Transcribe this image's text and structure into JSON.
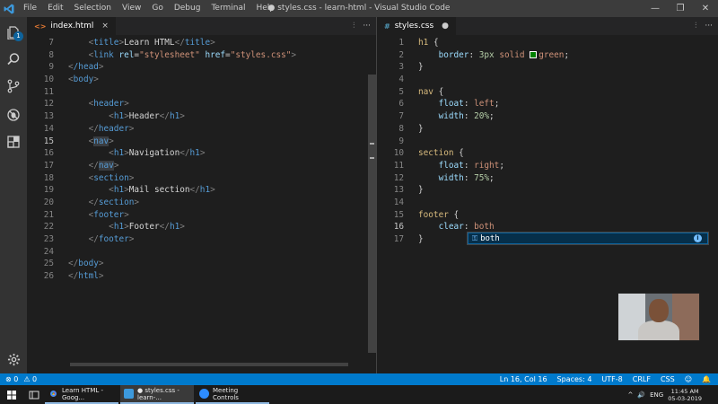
{
  "window": {
    "title": "● styles.css - learn-html - Visual Studio Code",
    "menu": [
      "File",
      "Edit",
      "Selection",
      "View",
      "Go",
      "Debug",
      "Terminal",
      "Help"
    ],
    "controls": [
      "—",
      "❐",
      "✕"
    ]
  },
  "activity": {
    "source_control_badge": "1",
    "icons": [
      "files-icon",
      "search-icon",
      "source-control-icon",
      "debug-icon",
      "extensions-icon",
      "settings-gear-icon"
    ]
  },
  "left_editor": {
    "tab": {
      "icon": "<>",
      "label": "index.html",
      "close": "×"
    },
    "actions": [
      "⫶",
      "···"
    ],
    "lines": [
      {
        "n": "7",
        "tokens": [
          [
            "    ",
            "txt"
          ],
          [
            "<",
            "br"
          ],
          [
            "title",
            "tag"
          ],
          [
            ">",
            "br"
          ],
          [
            "Learn HTML",
            "txt"
          ],
          [
            "</",
            "br"
          ],
          [
            "title",
            "tag"
          ],
          [
            ">",
            "br"
          ]
        ]
      },
      {
        "n": "8",
        "tokens": [
          [
            "    ",
            "txt"
          ],
          [
            "<",
            "br"
          ],
          [
            "link",
            "tag"
          ],
          [
            " ",
            "txt"
          ],
          [
            "rel",
            "attr"
          ],
          [
            "=",
            "txt"
          ],
          [
            "\"stylesheet\"",
            "str"
          ],
          [
            " ",
            "txt"
          ],
          [
            "href",
            "attr"
          ],
          [
            "=",
            "txt"
          ],
          [
            "\"styles.css\"",
            "str"
          ],
          [
            ">",
            "br"
          ]
        ]
      },
      {
        "n": "9",
        "tokens": [
          [
            "<",
            "br"
          ],
          [
            "/head",
            "tag"
          ],
          [
            ">",
            "br"
          ]
        ]
      },
      {
        "n": "10",
        "tokens": [
          [
            "<",
            "br"
          ],
          [
            "body",
            "tag"
          ],
          [
            ">",
            "br"
          ]
        ]
      },
      {
        "n": "11",
        "tokens": []
      },
      {
        "n": "12",
        "tokens": [
          [
            "    ",
            "txt"
          ],
          [
            "<",
            "br"
          ],
          [
            "header",
            "tag"
          ],
          [
            ">",
            "br"
          ]
        ]
      },
      {
        "n": "13",
        "tokens": [
          [
            "        ",
            "txt"
          ],
          [
            "<",
            "br"
          ],
          [
            "h1",
            "tag"
          ],
          [
            ">",
            "br"
          ],
          [
            "Header",
            "txt"
          ],
          [
            "</",
            "br"
          ],
          [
            "h1",
            "tag"
          ],
          [
            ">",
            "br"
          ]
        ]
      },
      {
        "n": "14",
        "tokens": [
          [
            "    ",
            "txt"
          ],
          [
            "</",
            "br"
          ],
          [
            "header",
            "tag"
          ],
          [
            ">",
            "br"
          ]
        ]
      },
      {
        "n": "15",
        "active": true,
        "tokens": [
          [
            "    ",
            "txt"
          ],
          [
            "<",
            "br"
          ],
          [
            "nav",
            "tag hl"
          ],
          [
            ">",
            "br"
          ]
        ]
      },
      {
        "n": "16",
        "tokens": [
          [
            "        ",
            "txt"
          ],
          [
            "<",
            "br"
          ],
          [
            "h1",
            "tag"
          ],
          [
            ">",
            "br"
          ],
          [
            "Navigation",
            "txt"
          ],
          [
            "</",
            "br"
          ],
          [
            "h1",
            "tag"
          ],
          [
            ">",
            "br"
          ]
        ]
      },
      {
        "n": "17",
        "tokens": [
          [
            "    ",
            "txt"
          ],
          [
            "</",
            "br"
          ],
          [
            "nav",
            "tag hl"
          ],
          [
            ">",
            "br"
          ]
        ]
      },
      {
        "n": "18",
        "tokens": [
          [
            "    ",
            "txt"
          ],
          [
            "<",
            "br"
          ],
          [
            "section",
            "tag"
          ],
          [
            ">",
            "br"
          ]
        ]
      },
      {
        "n": "19",
        "tokens": [
          [
            "        ",
            "txt"
          ],
          [
            "<",
            "br"
          ],
          [
            "h1",
            "tag"
          ],
          [
            ">",
            "br"
          ],
          [
            "Mail section",
            "txt"
          ],
          [
            "</",
            "br"
          ],
          [
            "h1",
            "tag"
          ],
          [
            ">",
            "br"
          ]
        ]
      },
      {
        "n": "20",
        "tokens": [
          [
            "    ",
            "txt"
          ],
          [
            "</",
            "br"
          ],
          [
            "section",
            "tag"
          ],
          [
            ">",
            "br"
          ]
        ]
      },
      {
        "n": "21",
        "tokens": [
          [
            "    ",
            "txt"
          ],
          [
            "<",
            "br"
          ],
          [
            "footer",
            "tag"
          ],
          [
            ">",
            "br"
          ]
        ]
      },
      {
        "n": "22",
        "tokens": [
          [
            "        ",
            "txt"
          ],
          [
            "<",
            "br"
          ],
          [
            "h1",
            "tag"
          ],
          [
            ">",
            "br"
          ],
          [
            "Footer",
            "txt"
          ],
          [
            "</",
            "br"
          ],
          [
            "h1",
            "tag"
          ],
          [
            ">",
            "br"
          ]
        ]
      },
      {
        "n": "23",
        "tokens": [
          [
            "    ",
            "txt"
          ],
          [
            "</",
            "br"
          ],
          [
            "footer",
            "tag"
          ],
          [
            ">",
            "br"
          ]
        ]
      },
      {
        "n": "24",
        "tokens": []
      },
      {
        "n": "25",
        "tokens": [
          [
            "</",
            "br"
          ],
          [
            "body",
            "tag"
          ],
          [
            ">",
            "br"
          ]
        ]
      },
      {
        "n": "26",
        "tokens": [
          [
            "</",
            "br"
          ],
          [
            "html",
            "tag"
          ],
          [
            ">",
            "br"
          ]
        ]
      }
    ]
  },
  "right_editor": {
    "tab": {
      "icon": "#",
      "label": "styles.css",
      "dirty": "●"
    },
    "actions": [
      "⫶",
      "···"
    ],
    "lines": [
      {
        "n": "1",
        "tokens": [
          [
            "h1",
            "sel"
          ],
          [
            " {",
            "pun"
          ]
        ]
      },
      {
        "n": "2",
        "tokens": [
          [
            "    ",
            "txt"
          ],
          [
            "border",
            "prop"
          ],
          [
            ": ",
            "pun"
          ],
          [
            "3px",
            "num"
          ],
          [
            " solid ",
            "val"
          ],
          [
            "SWATCH",
            "swatch"
          ],
          [
            "green",
            "val"
          ],
          [
            ";",
            "pun"
          ]
        ]
      },
      {
        "n": "3",
        "tokens": [
          [
            "}",
            "pun"
          ]
        ]
      },
      {
        "n": "4",
        "tokens": []
      },
      {
        "n": "5",
        "tokens": [
          [
            "nav",
            "sel"
          ],
          [
            " {",
            "pun"
          ]
        ]
      },
      {
        "n": "6",
        "tokens": [
          [
            "    ",
            "txt"
          ],
          [
            "float",
            "prop"
          ],
          [
            ": ",
            "pun"
          ],
          [
            "left",
            "val"
          ],
          [
            ";",
            "pun"
          ]
        ]
      },
      {
        "n": "7",
        "tokens": [
          [
            "    ",
            "txt"
          ],
          [
            "width",
            "prop"
          ],
          [
            ": ",
            "pun"
          ],
          [
            "20%",
            "num"
          ],
          [
            ";",
            "pun"
          ]
        ]
      },
      {
        "n": "8",
        "tokens": [
          [
            "}",
            "pun"
          ]
        ]
      },
      {
        "n": "9",
        "tokens": []
      },
      {
        "n": "10",
        "tokens": [
          [
            "section",
            "sel"
          ],
          [
            " {",
            "pun"
          ]
        ]
      },
      {
        "n": "11",
        "tokens": [
          [
            "    ",
            "txt"
          ],
          [
            "float",
            "prop"
          ],
          [
            ": ",
            "pun"
          ],
          [
            "right",
            "val"
          ],
          [
            ";",
            "pun"
          ]
        ]
      },
      {
        "n": "12",
        "tokens": [
          [
            "    ",
            "txt"
          ],
          [
            "width",
            "prop"
          ],
          [
            ": ",
            "pun"
          ],
          [
            "75%",
            "num"
          ],
          [
            ";",
            "pun"
          ]
        ]
      },
      {
        "n": "13",
        "tokens": [
          [
            "}",
            "pun"
          ]
        ]
      },
      {
        "n": "14",
        "tokens": []
      },
      {
        "n": "15",
        "tokens": [
          [
            "footer",
            "sel"
          ],
          [
            " {",
            "pun"
          ]
        ]
      },
      {
        "n": "16",
        "active": true,
        "tokens": [
          [
            "    ",
            "txt"
          ],
          [
            "clear",
            "prop"
          ],
          [
            ": ",
            "pun"
          ],
          [
            "both",
            "val"
          ]
        ]
      },
      {
        "n": "17",
        "tokens": [
          [
            "}",
            "pun"
          ]
        ]
      }
    ],
    "suggestion": {
      "icon": "⚿",
      "label": "both",
      "info": "i"
    }
  },
  "statusbar": {
    "errors": "⊗ 0",
    "warnings": "⚠ 0",
    "position": "Ln 16, Col 16",
    "spaces": "Spaces: 4",
    "encoding": "UTF-8",
    "eol": "CRLF",
    "language": "CSS",
    "feedback": "☺",
    "bell": "🔔"
  },
  "taskbar": {
    "apps": [
      {
        "label": "Learn HTML - Goog...",
        "color": "#e8453c"
      },
      {
        "label": "● styles.css - learn-...",
        "color": "#3c99dc"
      },
      {
        "label": "Meeting Controls",
        "color": "#2d8cff"
      }
    ],
    "tray": {
      "arrow": "^",
      "sound": "🔊",
      "lang": "ENG",
      "time": "11:45 AM",
      "date": "05-03-2019"
    }
  }
}
